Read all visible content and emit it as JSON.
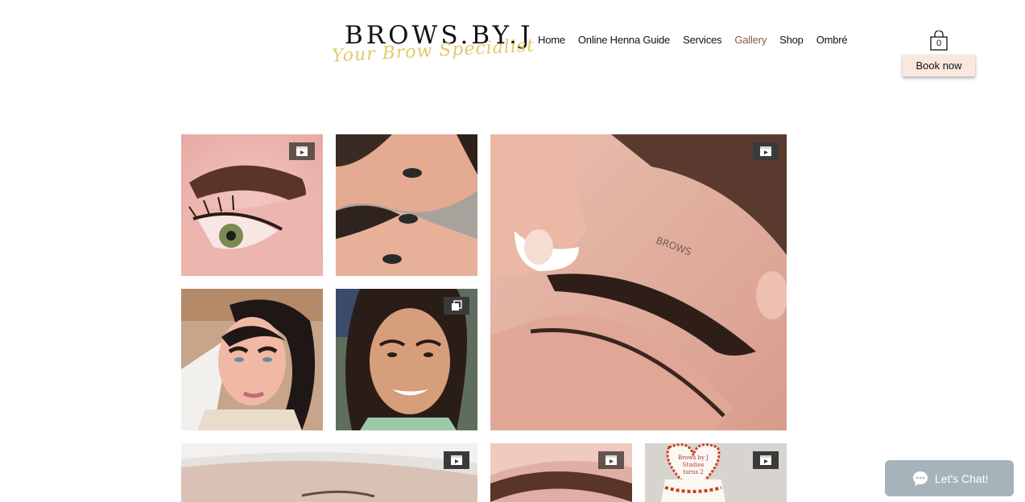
{
  "header": {
    "logo_main": "BROWS.BY.J",
    "logo_script": "Your Brow Specialist",
    "nav": [
      {
        "label": "Home",
        "active": false
      },
      {
        "label": "Online Henna Guide",
        "active": false
      },
      {
        "label": "Services",
        "active": false
      },
      {
        "label": "Gallery",
        "active": true
      },
      {
        "label": "Shop",
        "active": false
      },
      {
        "label": "Ombré",
        "active": false
      }
    ],
    "cart_count": "0",
    "book_label": "Book now"
  },
  "gallery": {
    "items": [
      {
        "name": "brow-closeup-eye",
        "badge": "video-icon"
      },
      {
        "name": "two-faces-mirror",
        "badge": ""
      },
      {
        "name": "brow-lamination-large",
        "badge": "video-icon"
      },
      {
        "name": "client-dark-hair",
        "badge": ""
      },
      {
        "name": "client-smiling",
        "badge": "multiple-images-icon"
      },
      {
        "name": "brow-treatment-wide",
        "badge": "video-icon"
      },
      {
        "name": "brow-closeup-2",
        "badge": "video-icon"
      },
      {
        "name": "heart-cake",
        "badge": "video-icon"
      }
    ],
    "cake_text": "Brows by J Studios turns 2"
  },
  "chat": {
    "label": "Let's Chat!"
  },
  "colors": {
    "accent": "#8a5a44",
    "book_bg": "#fae8df",
    "chat_bg": "#a7b3bb",
    "logo_gold": "#e0c45a"
  }
}
